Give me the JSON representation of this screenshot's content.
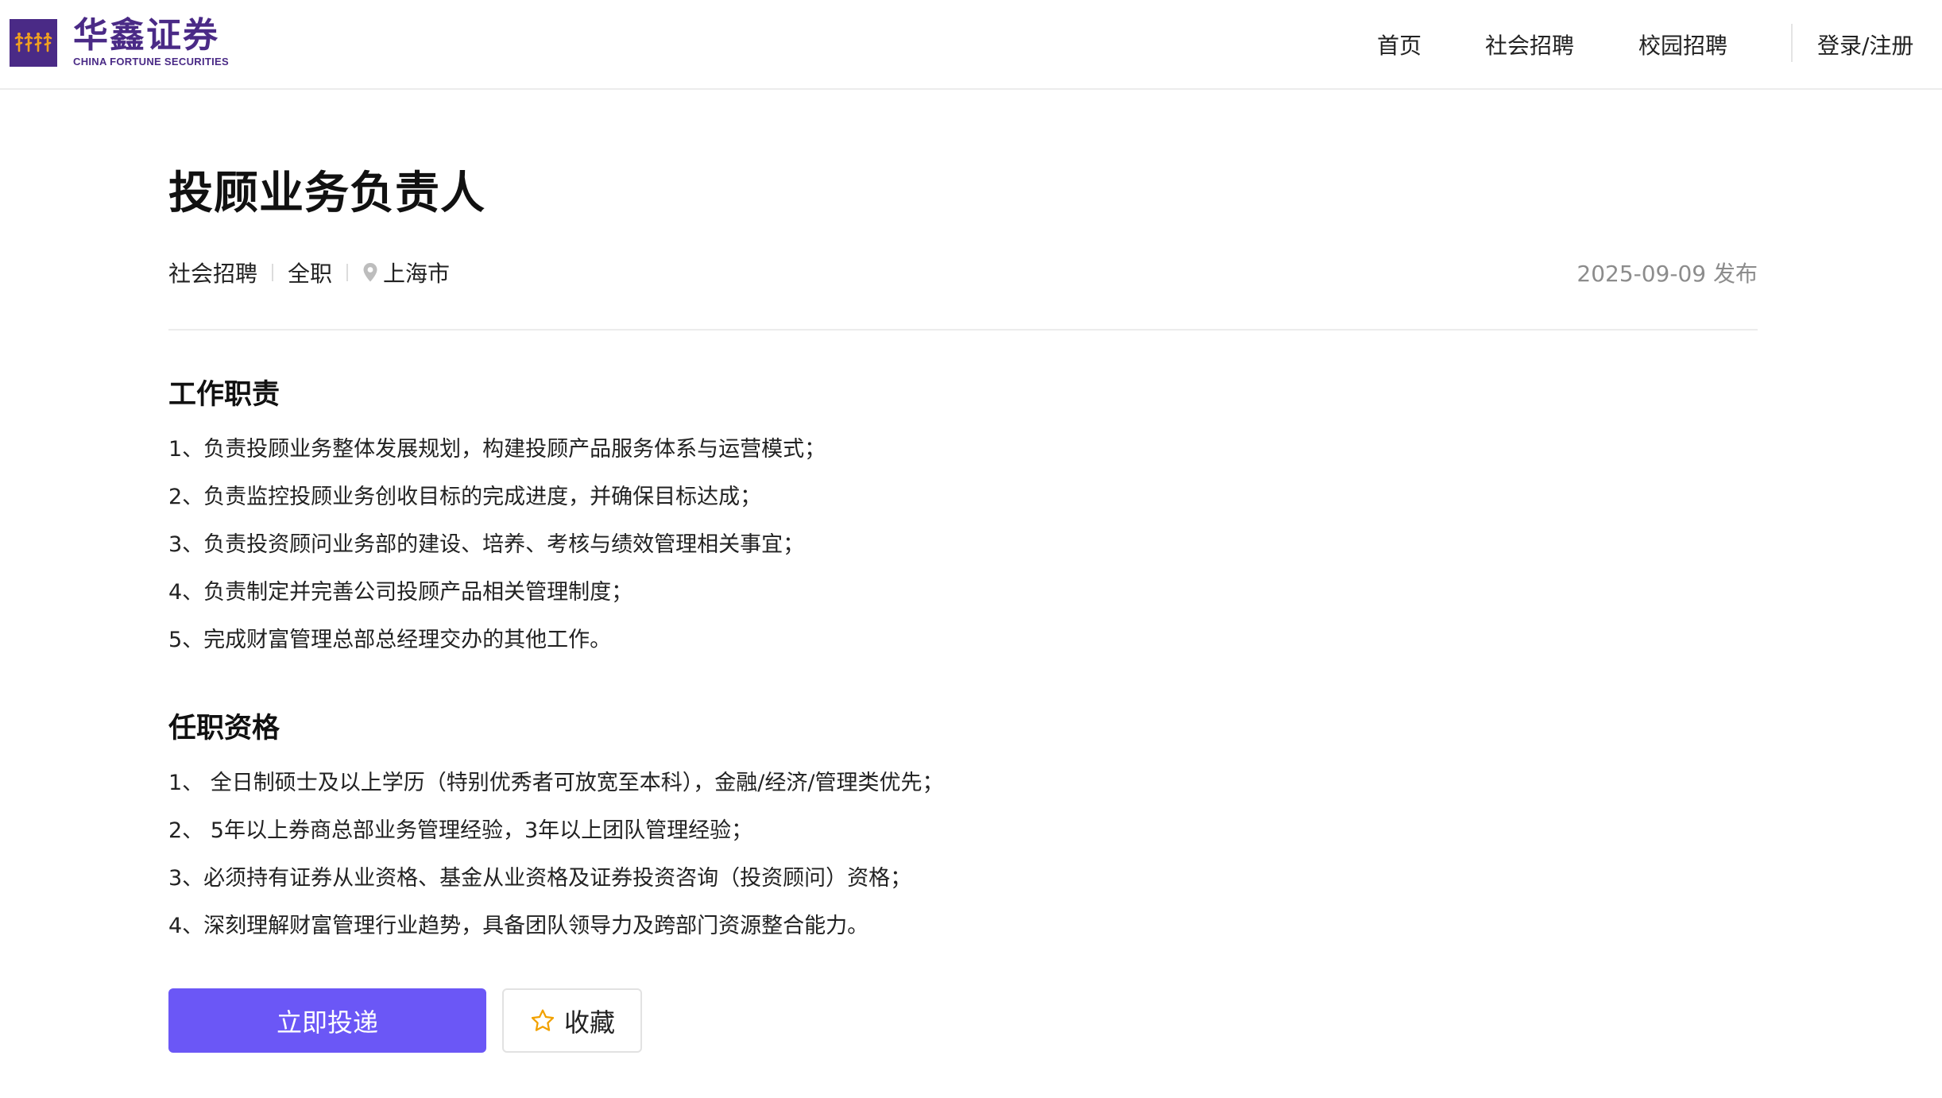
{
  "brand": {
    "name_cn": "华鑫证券",
    "name_en": "CHINA FORTUNE SECURITIES",
    "color": "#4a2a86"
  },
  "nav": {
    "home": "首页",
    "social": "社会招聘",
    "campus": "校园招聘",
    "login": "登录/注册"
  },
  "job": {
    "title": "投顾业务负责人",
    "type": "社会招聘",
    "employment": "全职",
    "location": "上海市",
    "location_icon": "location-pin-icon",
    "published": "2025-09-09 发布"
  },
  "sections": {
    "duties": {
      "title": "工作职责",
      "items": [
        "1、负责投顾业务整体发展规划，构建投顾产品服务体系与运营模式；",
        "2、负责监控投顾业务创收目标的完成进度，并确保目标达成；",
        "3、负责投资顾问业务部的建设、培养、考核与绩效管理相关事宜；",
        "4、负责制定并完善公司投顾产品相关管理制度；",
        "5、完成财富管理总部总经理交办的其他工作。"
      ]
    },
    "requirements": {
      "title": "任职资格",
      "items": [
        "1、 全日制硕士及以上学历（特别优秀者可放宽至本科），金融/经济/管理类优先；",
        "2、 5年以上券商总部业务管理经验，3年以上团队管理经验；",
        "3、必须持有证券从业资格、基金从业资格及证券投资咨询（投资顾问）资格；",
        "4、深刻理解财富管理行业趋势，具备团队领导力及跨部门资源整合能力。"
      ]
    }
  },
  "actions": {
    "apply": "立即投递",
    "favorite": "收藏",
    "favorite_icon": "star-icon",
    "apply_color": "#6b57f6"
  }
}
